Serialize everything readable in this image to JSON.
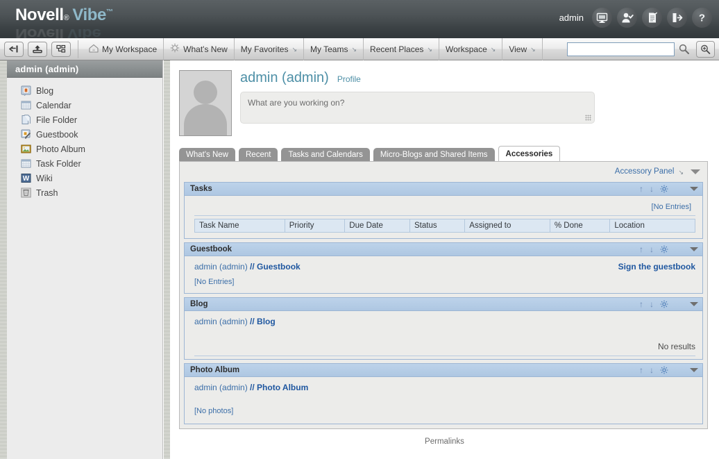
{
  "header": {
    "brand_primary": "Novell",
    "brand_reg": "®",
    "brand_secondary": "Vibe",
    "brand_tm": "™",
    "user_label": "admin",
    "icons": [
      {
        "name": "monitor-icon",
        "title": "Presence / Monitor"
      },
      {
        "name": "person-check-icon",
        "title": "My Profile"
      },
      {
        "name": "document-icon",
        "title": "Reports"
      },
      {
        "name": "logout-icon",
        "title": "Log out"
      },
      {
        "name": "help-icon",
        "title": "Help"
      }
    ]
  },
  "toolbar": {
    "buttons": [
      {
        "name": "back-button",
        "icon": "arrow-into-bracket-icon"
      },
      {
        "name": "upload-button",
        "icon": "upload-arrow-icon"
      },
      {
        "name": "tree-view-button",
        "icon": "hierarchy-tree-icon"
      }
    ],
    "menu": [
      {
        "label": "My Workspace",
        "icon": "home-icon",
        "has_arrow": false
      },
      {
        "label": "What's New",
        "icon": "gear-outline-icon",
        "has_arrow": false
      },
      {
        "label": "My Favorites",
        "icon": "",
        "has_arrow": true
      },
      {
        "label": "My Teams",
        "icon": "",
        "has_arrow": true
      },
      {
        "label": "Recent Places",
        "icon": "",
        "has_arrow": true
      },
      {
        "label": "Workspace",
        "icon": "",
        "has_arrow": true
      },
      {
        "label": "View",
        "icon": "",
        "has_arrow": true
      }
    ],
    "arrow_glyph": "↘",
    "search": {
      "value": "",
      "placeholder": ""
    },
    "search_button": "search-icon",
    "advanced_search_button": "advanced-search-icon"
  },
  "sidebar": {
    "title": "admin (admin)",
    "items": [
      {
        "label": "Blog",
        "icon": "blog-icon"
      },
      {
        "label": "Calendar",
        "icon": "calendar-icon"
      },
      {
        "label": "File Folder",
        "icon": "file-folder-icon"
      },
      {
        "label": "Guestbook",
        "icon": "guestbook-icon"
      },
      {
        "label": "Photo Album",
        "icon": "photo-album-icon"
      },
      {
        "label": "Task Folder",
        "icon": "task-folder-icon"
      },
      {
        "label": "Wiki",
        "icon": "wiki-icon"
      },
      {
        "label": "Trash",
        "icon": "trash-icon"
      }
    ]
  },
  "profile": {
    "name": "admin (admin)",
    "profile_link": "Profile",
    "status_placeholder": "What are you working on?",
    "status_value": "",
    "avatar": "default-user-avatar"
  },
  "tabs": [
    {
      "label": "What's New",
      "active": false
    },
    {
      "label": "Recent",
      "active": false
    },
    {
      "label": "Tasks and Calendars",
      "active": false
    },
    {
      "label": "Micro-Blogs and Shared Items",
      "active": false
    },
    {
      "label": "Accessories",
      "active": true
    }
  ],
  "accessory_panel": {
    "link": "Accessory Panel",
    "link_arrow": "↘",
    "collapse_icon": "chevron-down-icon"
  },
  "panels": [
    {
      "title": "Tasks",
      "type": "table",
      "no_entries": "[No Entries]",
      "columns": [
        "Task Name",
        "Priority",
        "Due Date",
        "Status",
        "Assigned to",
        "% Done",
        "Location"
      ],
      "rows": []
    },
    {
      "title": "Guestbook",
      "type": "guestbook",
      "crumb_owner": "admin (admin)",
      "crumb_sep": " // ",
      "crumb_target": "Guestbook",
      "action_link": "Sign the guestbook",
      "empty_text": "[No Entries]"
    },
    {
      "title": "Blog",
      "type": "blog",
      "crumb_owner": "admin (admin)",
      "crumb_sep": " // ",
      "crumb_target": "Blog",
      "empty_text": "No results"
    },
    {
      "title": "Photo Album",
      "type": "photos",
      "crumb_owner": "admin (admin)",
      "crumb_sep": " // ",
      "crumb_target": "Photo Album",
      "empty_text": "[No photos]"
    }
  ],
  "panel_tools": {
    "move_up": "↑",
    "move_down": "↓",
    "configure": "gear-icon",
    "collapse": "chevron-down-icon"
  },
  "footer": {
    "permalinks": "Permalinks"
  },
  "colors": {
    "header_dark": "#4d5356",
    "brand_teal": "#8fb8c9",
    "panel_header_blue": "#aec7e2",
    "panel_border_blue": "#9db6d4",
    "link_blue": "#3b6ea8",
    "link_bold_blue": "#1f57a0",
    "profile_teal": "#4d8fa6",
    "tab_inactive": "#949494",
    "sidebar_bg": "#ececec",
    "table_header_bg": "#dce7f2"
  }
}
